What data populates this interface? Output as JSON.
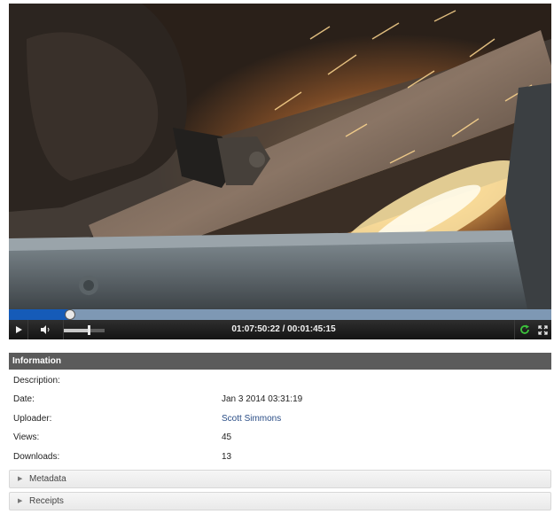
{
  "player": {
    "progress_fraction": 0.113,
    "volume_fraction": 0.6,
    "timecode": "01:07:50:22 / 00:01:45:15",
    "icons": {
      "play": "play-icon",
      "mute": "speaker-icon",
      "reload": "reload-icon",
      "fullscreen": "fullscreen-icon"
    },
    "colors": {
      "played": "#155bb8",
      "buffer": "#7e98b4",
      "reload": "#3cc33c"
    }
  },
  "info": {
    "header": "Information",
    "rows": [
      {
        "label": "Description:",
        "value": ""
      },
      {
        "label": "Date:",
        "value": "Jan 3 2014 03:31:19"
      },
      {
        "label": "Uploader:",
        "value": "Scott Simmons"
      },
      {
        "label": "Views:",
        "value": "45"
      },
      {
        "label": "Downloads:",
        "value": "13"
      }
    ]
  },
  "sections": [
    {
      "label": "Metadata"
    },
    {
      "label": "Receipts"
    }
  ]
}
